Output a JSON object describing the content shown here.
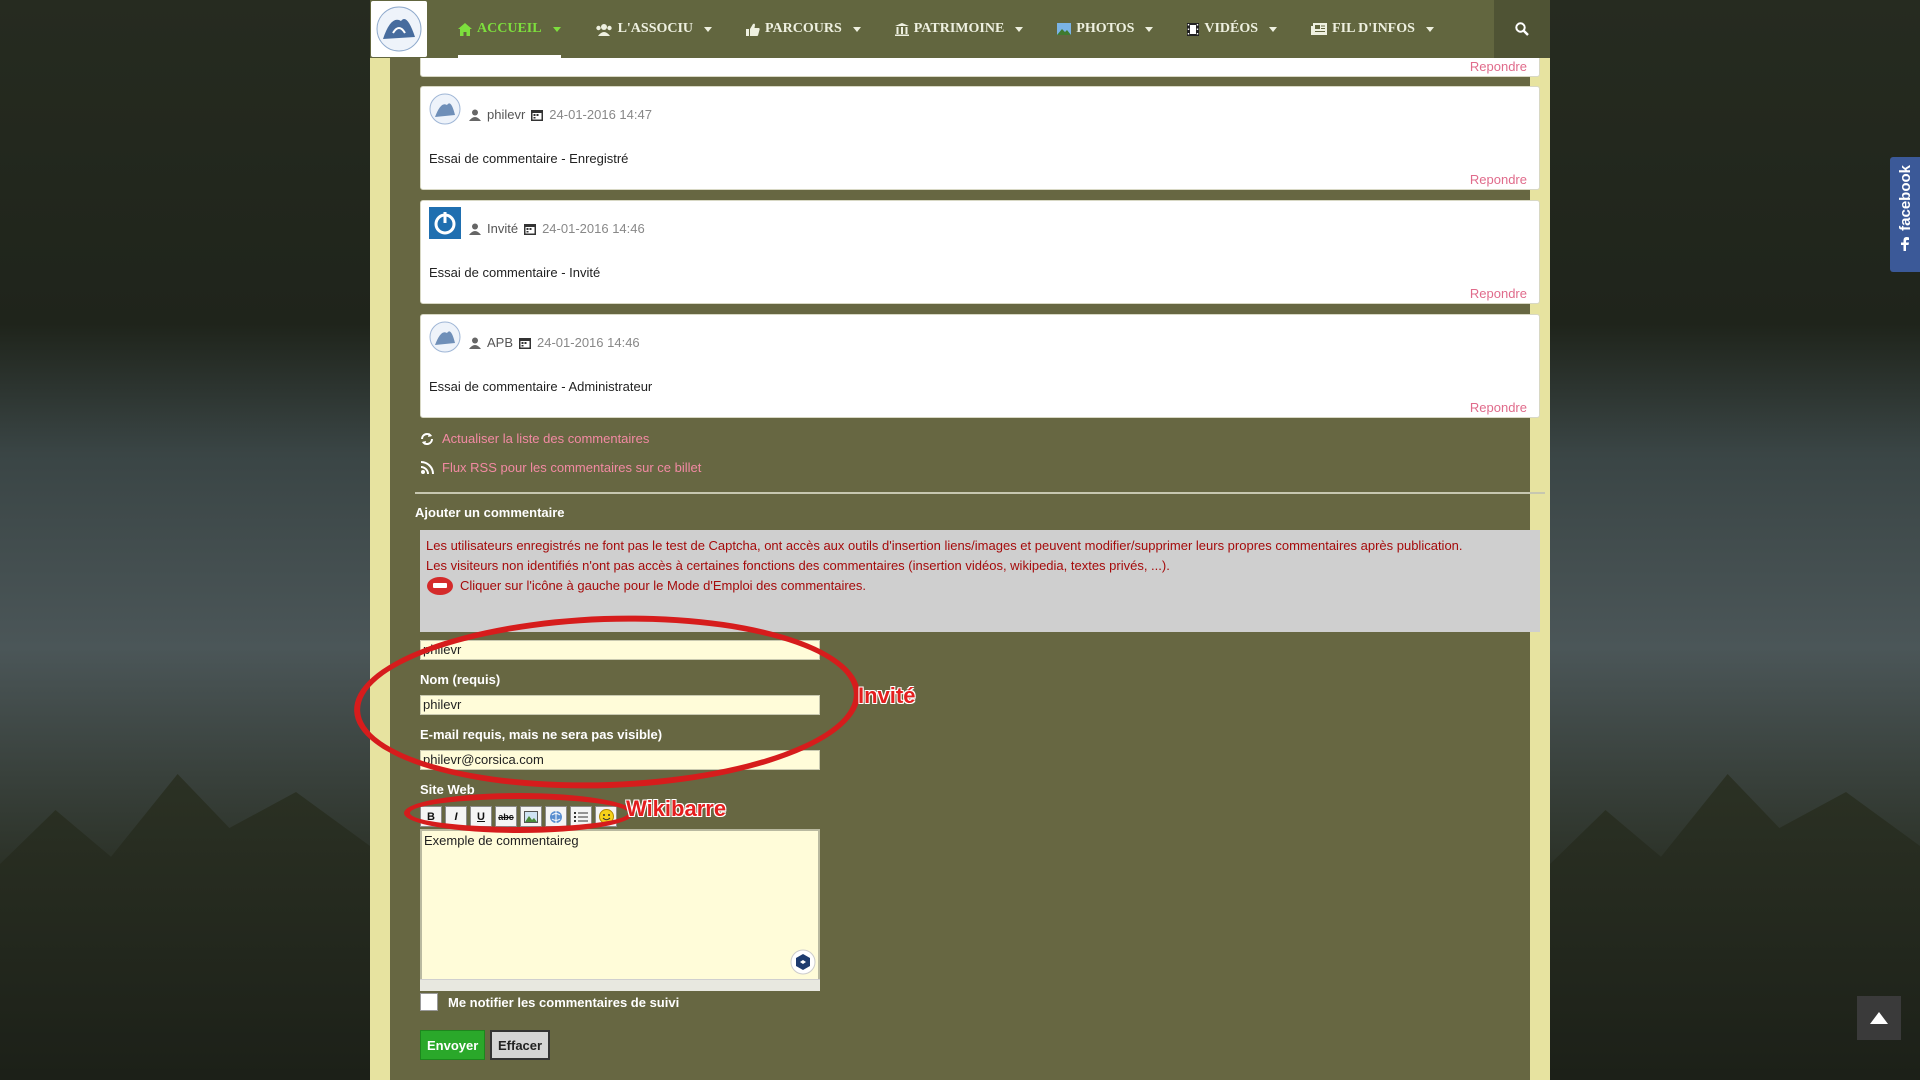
{
  "nav": {
    "items": [
      {
        "label": "ACCUEIL",
        "icon": "home-icon"
      },
      {
        "label": "L'ASSOCIU",
        "icon": "users-icon"
      },
      {
        "label": "PARCOURS",
        "icon": "thumbs-up-icon"
      },
      {
        "label": "PATRIMOINE",
        "icon": "building-icon"
      },
      {
        "label": "PHOTOS",
        "icon": "image-icon"
      },
      {
        "label": "VIDÉOS",
        "icon": "film-icon"
      },
      {
        "label": "FIL D'INFOS",
        "icon": "newspaper-icon"
      }
    ],
    "search_icon": "search-icon"
  },
  "comments": [
    {
      "author": "",
      "date": "",
      "text": "",
      "reply": "Repondre"
    },
    {
      "author": "philevr",
      "date": "24-01-2016 14:47",
      "text": "Essai de commentaire - Enregistré",
      "reply": "Repondre"
    },
    {
      "author": "Invité",
      "date": "24-01-2016 14:46",
      "text": "Essai de commentaire - Invité",
      "reply": "Repondre"
    },
    {
      "author": "APB",
      "date": "24-01-2016 14:46",
      "text": "Essai de commentaire - Administrateur",
      "reply": "Repondre"
    }
  ],
  "links": {
    "refresh": "Actualiser la liste des commentaires",
    "rss": "Flux RSS pour les commentaires sur ce billet"
  },
  "form": {
    "title": "Ajouter un commentaire",
    "info_line1": "Les utilisateurs enregistrés ne font pas le test de Captcha, ont accès aux outils d'insertion liens/images et peuvent modifier/supprimer leurs propres commentaires après publication.",
    "info_line2": "Les visiteurs non identifiés n'ont pas accès à certaines fonctions des commentaires (insertion vidéos, wikipedia, textes privés, ...).",
    "help_link": "Cliquer sur l'icône à gauche pour le Mode d'Emploi des commentaires.",
    "top_field_value": "philevr",
    "name_label": "Nom (requis)",
    "name_value": "philevr",
    "email_label": "E-mail requis, mais ne sera pas visible)",
    "email_value": "philevr@corsica.com",
    "site_label": "Site Web",
    "toolbar": [
      {
        "label": "B",
        "icon": "bold-icon"
      },
      {
        "label": "I",
        "icon": "italic-icon"
      },
      {
        "label": "U",
        "icon": "underline-icon"
      },
      {
        "label": "abc",
        "icon": "strikethrough-icon"
      },
      {
        "label": "",
        "icon": "image-icon"
      },
      {
        "label": "",
        "icon": "link-icon"
      },
      {
        "label": "",
        "icon": "list-icon"
      },
      {
        "label": "",
        "icon": "smiley-icon"
      }
    ],
    "comment_value": "Exemple de commentaireg",
    "notify_label": "Me notifier les commentaires de suivi",
    "send_label": "Envoyer",
    "clear_label": "Effacer"
  },
  "annotations": {
    "guest_label": "Invité",
    "wikibar_label": "Wikibarre",
    "color": "#d61c1c"
  },
  "facebook_tab": "facebook",
  "colors": {
    "navbar": "#62663f",
    "active_nav": "#7ddf3d",
    "content_bg": "#676742",
    "page_border": "#e7e3a0",
    "link_pink": "#e06b8b",
    "info_text": "#a50b0b",
    "send_green": "#2aa82a",
    "facebook_blue": "#3b5998"
  }
}
